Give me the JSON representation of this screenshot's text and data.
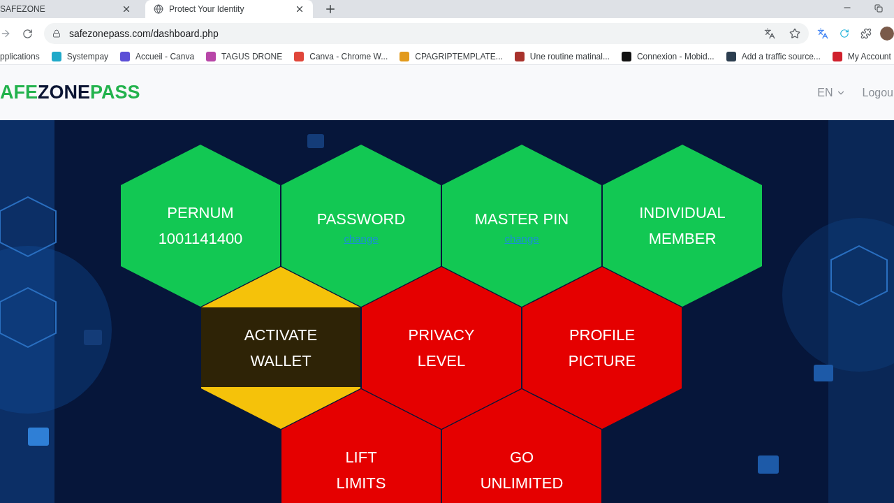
{
  "browser": {
    "tabs": [
      {
        "title": "SAFEZONE",
        "selected": false
      },
      {
        "title": "Protect Your Identity",
        "selected": true
      }
    ],
    "address": "safezonepass.com/dashboard.php",
    "bookmarks": [
      {
        "label": "pplications"
      },
      {
        "label": "Systempay",
        "color": "#1fa9c9"
      },
      {
        "label": "Accueil - Canva",
        "color": "#5b4fd6"
      },
      {
        "label": "TAGUS DRONE",
        "color": "#b846a8"
      },
      {
        "label": "Canva - Chrome W...",
        "color": "#e0463a"
      },
      {
        "label": "CPAGRIPTEMPLATE...",
        "color": "#e29a1c"
      },
      {
        "label": "Une routine matinal...",
        "color": "#a8322c"
      },
      {
        "label": "Connexion - Mobid...",
        "color": "#111111"
      },
      {
        "label": "Add a traffic source...",
        "color": "#2c3e50"
      },
      {
        "label": "My Account",
        "color": "#d0202c"
      }
    ]
  },
  "header": {
    "logo": [
      {
        "text": "AFE",
        "color": "#22b24c"
      },
      {
        "text": "ZONE",
        "color": "#0b1533"
      },
      {
        "text": "PASS",
        "color": "#22b24c"
      }
    ],
    "language": "EN",
    "logout": "Logou"
  },
  "tiles": [
    [
      {
        "lines": [
          "PERNUM",
          "1001141400"
        ],
        "color": "#12c853",
        "hovered": false
      },
      {
        "lines": [
          "PASSWORD"
        ],
        "link": "change",
        "color": "#12c853",
        "hovered": false
      },
      {
        "lines": [
          "MASTER PIN"
        ],
        "link": "change",
        "color": "#12c853",
        "hovered": false
      },
      {
        "lines": [
          "INDIVIDUAL",
          "MEMBER"
        ],
        "color": "#12c853",
        "hovered": false
      }
    ],
    [
      {
        "lines": [
          "ACTIVATE",
          "WALLET"
        ],
        "color": "#f5c20a",
        "hovered": true
      },
      {
        "lines": [
          "PRIVACY",
          "LEVEL"
        ],
        "color": "#e50000",
        "hovered": false
      },
      {
        "lines": [
          "PROFILE",
          "PICTURE"
        ],
        "color": "#e50000",
        "hovered": false
      }
    ],
    [
      {
        "lines": [
          "LIFT",
          "LIMITS"
        ],
        "color": "#e50000",
        "hovered": false
      },
      {
        "lines": [
          "GO",
          "UNLIMITED"
        ],
        "color": "#e50000",
        "hovered": false
      }
    ]
  ]
}
